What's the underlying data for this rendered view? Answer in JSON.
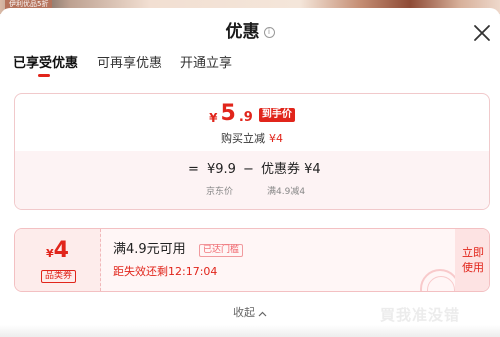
{
  "background": {
    "promo_text": "伊利优品5折"
  },
  "header": {
    "title": "优惠",
    "info_icon": "info-circle-icon",
    "close_icon": "close-icon"
  },
  "tabs": [
    {
      "label": "已享受优惠",
      "active": true
    },
    {
      "label": "可再享优惠",
      "active": false
    },
    {
      "label": "开通立享",
      "active": false
    }
  ],
  "price_summary": {
    "currency": "¥",
    "final_price_int": "5",
    "final_price_dec": ".9",
    "final_tag": "到手价",
    "instant_label": "购买立减",
    "instant_amount": "¥4",
    "formula": {
      "equals": "=",
      "jd_price": "¥9.9",
      "minus": "−",
      "coupon": "优惠券 ¥4"
    },
    "formula_sub": {
      "jd_price_label": "京东价",
      "coupon_rule": "满4.9减4"
    }
  },
  "coupon": {
    "currency": "¥",
    "amount": "4",
    "type": "品类券",
    "condition": "满4.9元可用",
    "threshold_badge": "已达门槛",
    "countdown": "距失效还剩12:17:04",
    "action_line1": "立即",
    "action_line2": "使用"
  },
  "collapse": {
    "label": "收起"
  },
  "watermark": {
    "text": "買我准没错"
  },
  "colors": {
    "accent": "#e1251b",
    "card_border": "#f1c9cb",
    "card_tint": "#fdf3f4"
  }
}
